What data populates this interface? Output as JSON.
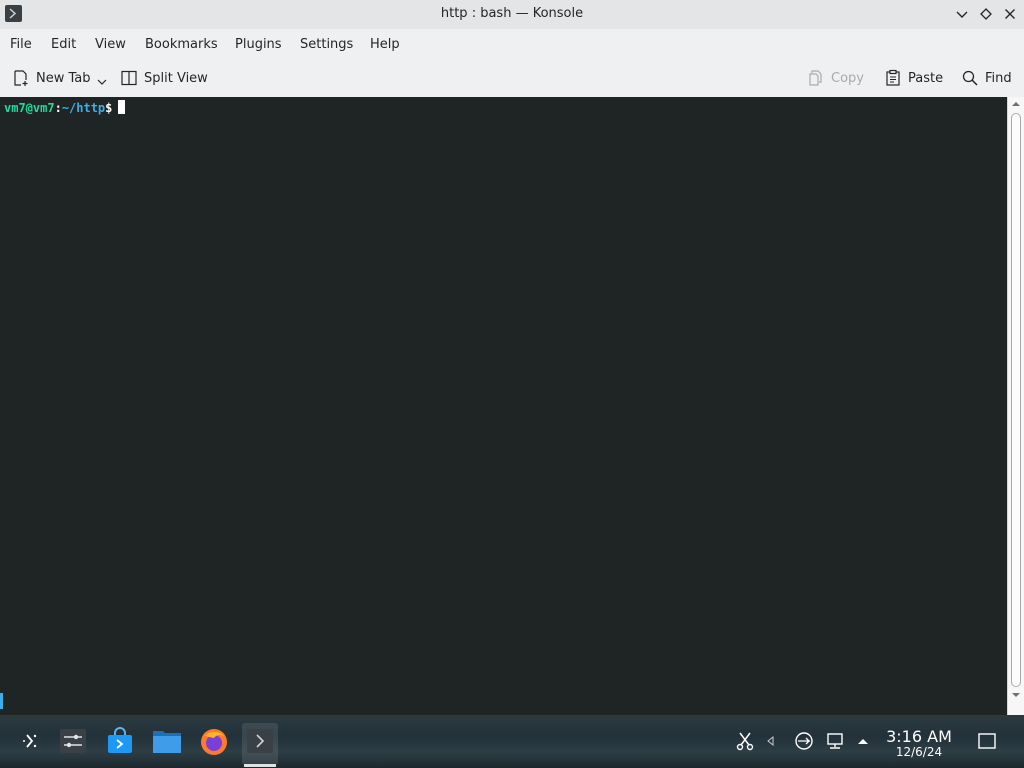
{
  "window": {
    "title": "http : bash — Konsole",
    "app_icon": "terminal-icon"
  },
  "menubar": {
    "items": [
      "File",
      "Edit",
      "View",
      "Bookmarks",
      "Plugins",
      "Settings",
      "Help"
    ]
  },
  "toolbar": {
    "new_tab_label": "New Tab",
    "split_view_label": "Split View",
    "copy_label": "Copy",
    "paste_label": "Paste",
    "find_label": "Find"
  },
  "terminal": {
    "prompt_user": "vm7@vm7",
    "prompt_colon": ":",
    "prompt_path": "~/http",
    "prompt_symbol": "$"
  },
  "taskbar": {
    "launchers": [
      "application-launcher-icon",
      "system-settings-icon",
      "discover-store-icon",
      "file-manager-icon",
      "firefox-icon",
      "konsole-icon"
    ],
    "tray": [
      "clipboard-scissors-icon",
      "volume-icon",
      "usb-network-icon",
      "network-icon",
      "expand-tray-icon"
    ],
    "clock_time": "3:16 AM",
    "clock_date": "12/6/24"
  },
  "colors": {
    "terminal_bg": "#1f2524",
    "prompt_user": "#1cdc9a",
    "prompt_path": "#3daee9",
    "accent": "#3daee9"
  }
}
